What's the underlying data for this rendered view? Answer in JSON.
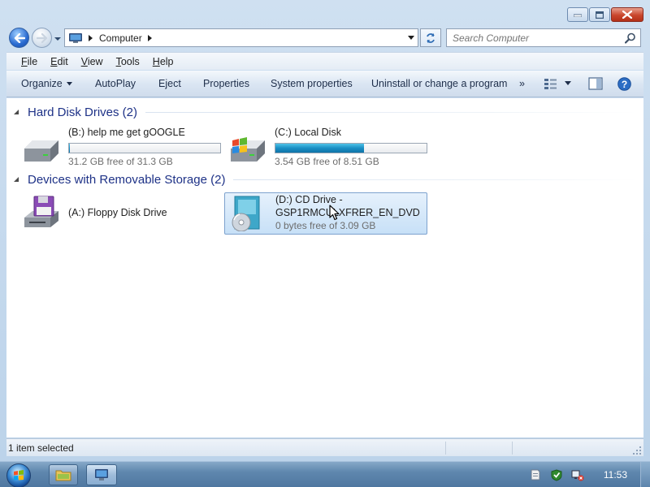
{
  "window": {
    "caption_buttons": [
      "minimize-icon",
      "maximize-icon",
      "close-icon"
    ]
  },
  "address": {
    "location_icon": "computer-icon",
    "breadcrumb": [
      "Computer"
    ],
    "search_placeholder": "Search Computer"
  },
  "menu": {
    "items": [
      {
        "label": "File",
        "access_key": "F",
        "rest": "ile"
      },
      {
        "label": "Edit",
        "access_key": "E",
        "rest": "dit"
      },
      {
        "label": "View",
        "access_key": "V",
        "rest": "iew"
      },
      {
        "label": "Tools",
        "access_key": "T",
        "rest": "ools"
      },
      {
        "label": "Help",
        "access_key": "H",
        "rest": "elp"
      }
    ]
  },
  "commands": {
    "organize": "Organize",
    "autoplay": "AutoPlay",
    "eject": "Eject",
    "properties": "Properties",
    "system_properties": "System properties",
    "uninstall": "Uninstall or change a program",
    "more": "»"
  },
  "groups": [
    {
      "title": "Hard Disk Drives (2)",
      "drives": [
        {
          "name": "(B:) help me get gOOGLE",
          "free": "31.2 GB free of 31.3 GB",
          "used_fraction": 0.003,
          "icon": "hard-drive-icon"
        },
        {
          "name": "(C:) Local Disk",
          "free": "3.54 GB free of 8.51 GB",
          "used_fraction": 0.584,
          "icon": "windows-drive-icon"
        }
      ]
    },
    {
      "title": "Devices with Removable Storage (2)",
      "drives": [
        {
          "name": "(A:) Floppy Disk Drive",
          "icon": "floppy-drive-icon"
        },
        {
          "name_line1": "(D:) CD Drive -",
          "name_line2": "GSP1RMCULXFRER_EN_DVD",
          "free": "0 bytes free of 3.09 GB",
          "icon": "dvd-drive-icon",
          "selected": true
        }
      ]
    }
  ],
  "status": {
    "text": "1 item selected"
  },
  "taskbar": {
    "clock": "11:53",
    "pinned": [
      "explorer-icon",
      "computer-taskbar-icon"
    ],
    "tray": [
      "action-center-icon",
      "network-icon",
      "volume-muted-icon"
    ]
  }
}
